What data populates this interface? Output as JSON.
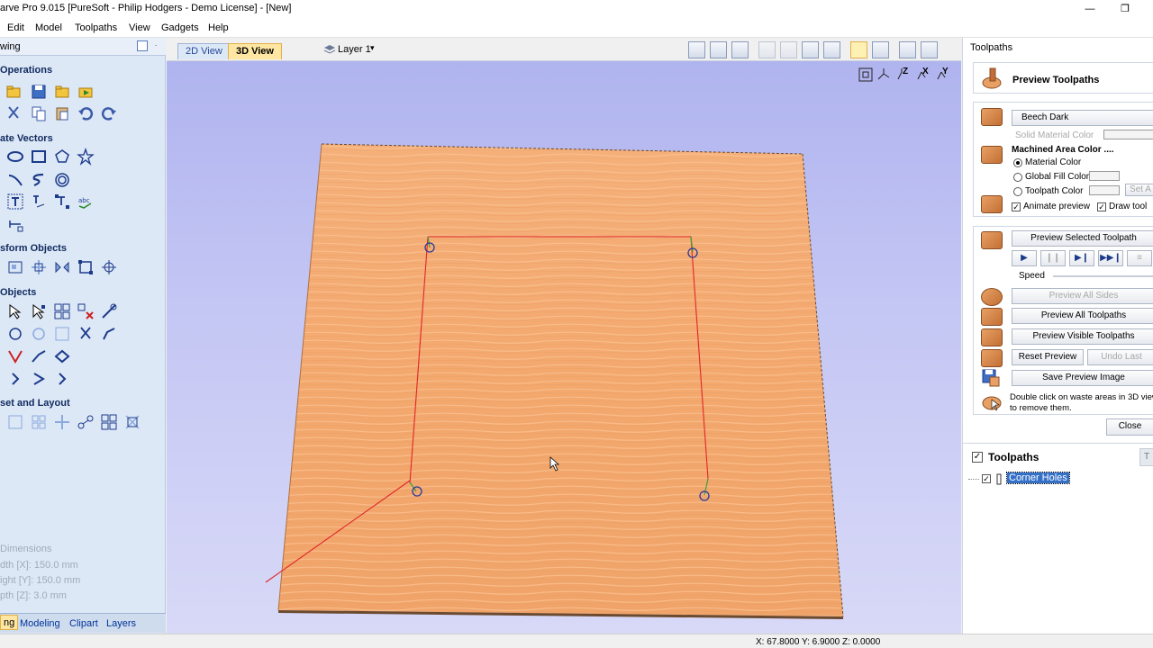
{
  "window": {
    "title": "arve Pro 9.015 [PureSoft - Philip Hodgers - Demo License] - [New]",
    "minimize": "—",
    "restore": "❐"
  },
  "menubar": [
    "Edit",
    "Model",
    "Toolpaths",
    "View",
    "Gadgets",
    "Help"
  ],
  "left_panel": {
    "title": "wing",
    "pin": "·",
    "sections": {
      "operations": "Operations",
      "create_vectors": "ate Vectors",
      "transform_objects": "sform Objects",
      "edit_objects": "Objects",
      "offset_layout": "set and Layout"
    },
    "dimensions": {
      "header": "Dimensions",
      "width": "dth  [X]: 150.0 mm",
      "height": "ight [Y]: 150.0 mm",
      "depth": "pth  [Z]: 3.0 mm"
    },
    "tabs": [
      "ng",
      "Modeling",
      "Clipart",
      "Layers"
    ]
  },
  "viewport": {
    "tabs": [
      "2D View",
      "3D View"
    ],
    "active_tab": "3D View",
    "layer": "Layer 1",
    "view_axes": [
      "Z",
      "X",
      "Y"
    ]
  },
  "right_panel": {
    "header": "Toolpaths",
    "preview_title": "Preview Toolpaths",
    "material": "Beech Dark",
    "solid_material_color": "Solid Material Color",
    "machined_area_color": "Machined Area Color ....",
    "radio_options": [
      "Material Color",
      "Global Fill Color",
      "Toolpath Color"
    ],
    "set_all": "Set A",
    "animate_preview": "Animate preview",
    "draw_tool": "Draw tool",
    "preview_selected": "Preview Selected Toolpath",
    "play_controls": [
      "▶",
      "❙❙",
      "▶❙",
      "▶▶❙",
      "≡"
    ],
    "speed": "Speed",
    "preview_all_sides": "Preview All Sides",
    "preview_all_toolpaths": "Preview All Toolpaths",
    "preview_visible_toolpaths": "Preview Visible Toolpaths",
    "reset_preview": "Reset Preview",
    "undo_last": "Undo Last",
    "save_preview_image": "Save Preview Image",
    "hint_line1": "Double click on waste areas in 3D view",
    "hint_line2": "to remove them.",
    "close": "Close",
    "toolpaths_list_title": "Toolpaths",
    "toolpath_items": [
      "Corner Holes"
    ]
  },
  "statusbar": {
    "coords": "X: 67.8000 Y:   6.9000 Z:   0.0000"
  },
  "colors": {
    "board": "#f0a86e",
    "toolpath": "#e0262a",
    "holes": "#2a3a9a",
    "selected_item": "#3470c8"
  }
}
